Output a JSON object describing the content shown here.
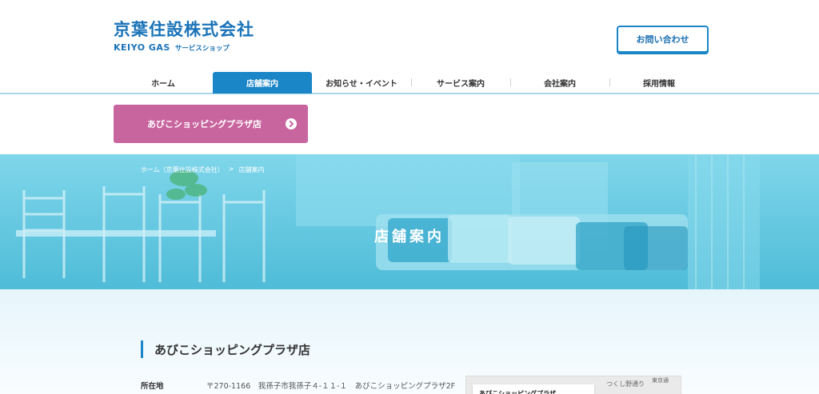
{
  "header": {
    "company_name": "京葉住設株式会社",
    "brand": "KEIYO GAS",
    "shop_label": "サービスショップ",
    "contact_button": "お問い合わせ"
  },
  "nav": {
    "items": [
      {
        "label": "ホーム"
      },
      {
        "label": "店舗案内"
      },
      {
        "label": "お知らせ・イベント"
      },
      {
        "label": "サービス案内"
      },
      {
        "label": "会社案内"
      },
      {
        "label": "採用情報"
      }
    ]
  },
  "store_button": {
    "label": "あびこショッピングプラザ店"
  },
  "hero": {
    "breadcrumb_home": "ホーム（京葉住設株式会社）",
    "breadcrumb_sep": ">",
    "breadcrumb_current": "店舗案内",
    "title": "店舗案内"
  },
  "content": {
    "section_title": "あびこショッピングプラザ店",
    "address_label": "所在地",
    "address_value": "〒270-1166　我孫子市我孫子４-１１-１　あびこショッピングプラザ2F",
    "map_card": "あびこショッピングプラザ",
    "map_road": "つくし野通り",
    "map_road2": "東京通"
  },
  "colors": {
    "accent": "#1a86c8",
    "store_button": "#c8649e",
    "hero_bg": "#5ec7df"
  }
}
